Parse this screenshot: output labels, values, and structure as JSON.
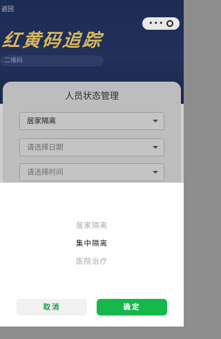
{
  "header": {
    "back_text": "返回",
    "title": "红黄码追踪",
    "subtitle": "二维码"
  },
  "dialog": {
    "title": "人员状态管理",
    "status_value": "居家隔离",
    "date_placeholder": "请选择日期",
    "time_placeholder": "请选择时间"
  },
  "picker": {
    "options": [
      "居家隔离",
      "集中隔离",
      "医院治疗"
    ],
    "selected_index": 1,
    "cancel_label": "取消",
    "confirm_label": "确定"
  },
  "colors": {
    "confirm_button": "#15b84b",
    "cancel_text": "#1f9a53"
  },
  "icons": [
    "more-dots-icon",
    "close-ring-icon",
    "chevron-down-icon"
  ]
}
